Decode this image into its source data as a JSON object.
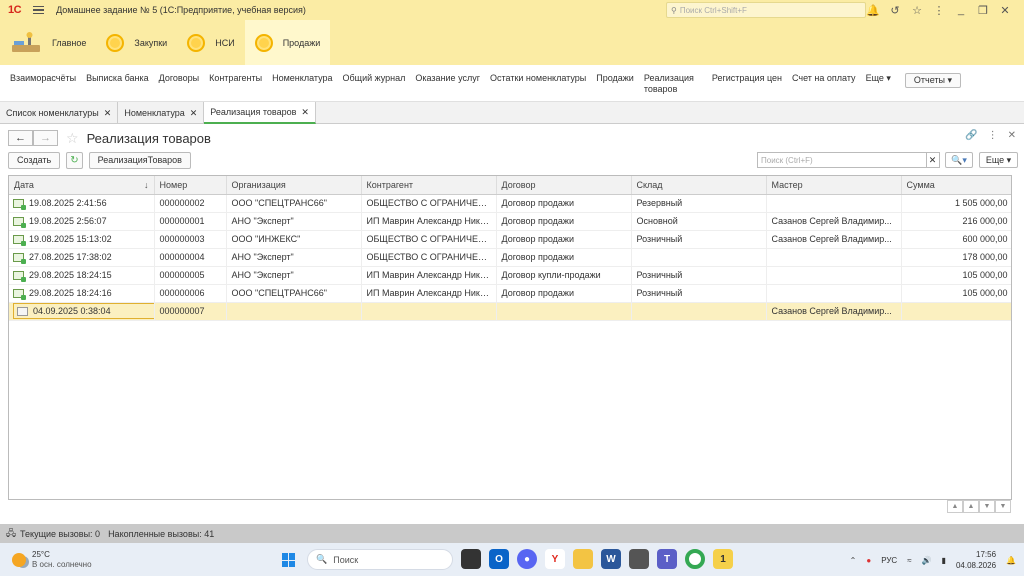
{
  "titlebar": {
    "logo": "1С",
    "title": "Домашнее задание № 5  (1С:Предприятие, учебная версия)",
    "search_placeholder": "Поиск Ctrl+Shift+F"
  },
  "sections": [
    {
      "label": "Главное",
      "icon": "home-icon"
    },
    {
      "label": "Закупки",
      "icon": "coin-icon"
    },
    {
      "label": "НСИ",
      "icon": "coin-icon"
    },
    {
      "label": "Продажи",
      "icon": "coin-icon",
      "active": true
    }
  ],
  "commands": [
    "Взаиморасчёты",
    "Выписка банка",
    "Договоры",
    "Контрагенты",
    "Номенклатура",
    "Общий журнал",
    "Оказание услуг",
    "Остатки номенклатуры",
    "Продажи",
    "Реализация товаров",
    "Регистрация цен",
    "Счет на оплату"
  ],
  "commands_more": "Еще",
  "commands_reports": "Отчеты",
  "tabs": [
    {
      "label": "Список номенклатуры"
    },
    {
      "label": "Номенклатура"
    },
    {
      "label": "Реализация товаров",
      "active": true
    }
  ],
  "form": {
    "title": "Реализация товаров",
    "create_label": "Создать",
    "doc_button_label": "РеализацияТоваров",
    "search_placeholder": "Поиск (Ctrl+F)",
    "more_label": "Еще"
  },
  "table": {
    "columns": [
      "Дата",
      "Номер",
      "Организация",
      "Контрагент",
      "Договор",
      "Склад",
      "Мастер",
      "Сумма"
    ],
    "rows": [
      {
        "date": "19.08.2025 2:41:56",
        "number": "000000002",
        "org": "ООО \"СПЕЦТРАНС66\"",
        "counterparty": "ОБЩЕСТВО С ОГРАНИЧЕН...",
        "contract": "Договор продажи",
        "warehouse": "Резервный",
        "master": "",
        "sum": "1 505 000,00"
      },
      {
        "date": "19.08.2025 2:56:07",
        "number": "000000001",
        "org": "АНО \"Эксперт\"",
        "counterparty": "ИП Маврин Александр Нико...",
        "contract": "Договор продажи",
        "warehouse": "Основной",
        "master": "Сазанов Сергей Владимир...",
        "sum": "216 000,00"
      },
      {
        "date": "19.08.2025 15:13:02",
        "number": "000000003",
        "org": "ООО \"ИНЖЕКС\"",
        "counterparty": "ОБЩЕСТВО С ОГРАНИЧЕН...",
        "contract": "Договор продажи",
        "warehouse": "Розничный",
        "master": "Сазанов Сергей Владимир...",
        "sum": "600 000,00"
      },
      {
        "date": "27.08.2025 17:38:02",
        "number": "000000004",
        "org": "АНО \"Эксперт\"",
        "counterparty": "ОБЩЕСТВО С ОГРАНИЧЕН...",
        "contract": "Договор продажи",
        "warehouse": "",
        "master": "",
        "sum": "178 000,00"
      },
      {
        "date": "29.08.2025 18:24:15",
        "number": "000000005",
        "org": "АНО \"Эксперт\"",
        "counterparty": "ИП Маврин Александр Нико...",
        "contract": "Договор купли-продажи",
        "warehouse": "Розничный",
        "master": "",
        "sum": "105 000,00"
      },
      {
        "date": "29.08.2025 18:24:16",
        "number": "000000006",
        "org": "ООО \"СПЕЦТРАНС66\"",
        "counterparty": "ИП Маврин Александр Нико...",
        "contract": "Договор продажи",
        "warehouse": "Розничный",
        "master": "",
        "sum": "105 000,00"
      },
      {
        "date": "04.09.2025 0:38:04",
        "number": "000000007",
        "org": "",
        "counterparty": "",
        "contract": "",
        "warehouse": "",
        "master": "Сазанов Сергей Владимир...",
        "sum": "",
        "selected": true,
        "draft": true
      }
    ]
  },
  "statusbar": {
    "current_calls": "Текущие вызовы: 0",
    "accumulated_calls": "Накопленные вызовы: 41"
  },
  "taskbar": {
    "temperature": "25°C",
    "weather": "В осн. солнечно",
    "search_label": "Поиск",
    "lang": "РУС",
    "time": "17:56",
    "date": "04.08.2026"
  }
}
